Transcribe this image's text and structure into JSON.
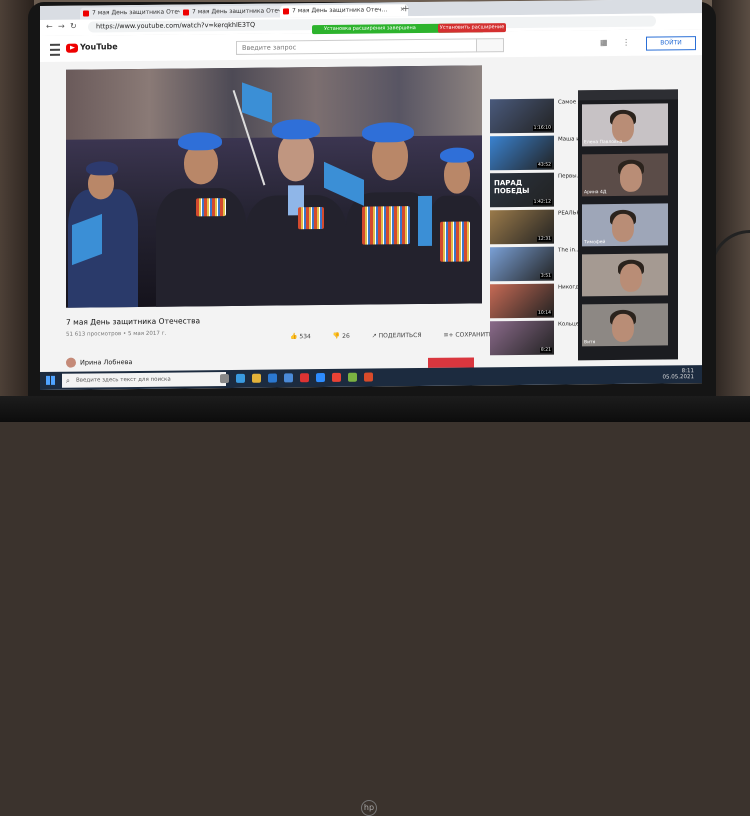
{
  "browser": {
    "tabs": [
      {
        "label": "7 мая День защитника Отеч…",
        "active": false
      },
      {
        "label": "7 мая День защитника Отеч…",
        "active": false
      },
      {
        "label": "7 мая День защитника Отеч…",
        "active": true
      }
    ],
    "url": "https://www.youtube.com/watch?v=kerqkhlE3TQ"
  },
  "youtube": {
    "logo_text": "YouTube",
    "search_placeholder": "Введите запрос",
    "notice_text": "Установка расширения завершена",
    "notice_button": "Установить расширение",
    "signin_label": "ВОЙТИ"
  },
  "video": {
    "title": "7 мая День защитника Отечества",
    "meta": "51 613 просмотров • 5 мая 2017 г.",
    "likes": "534",
    "dislikes": "26",
    "share_label": "ПОДЕЛИТЬСЯ",
    "save_label": "СОХРАНИТЬ",
    "channel": "Ирина Лобнева"
  },
  "suggestions": [
    {
      "title": "Самое т… истори…",
      "duration": "1:16:10",
      "color": "#4a5a7c"
    },
    {
      "title": "Маша и… Эпизод…",
      "duration": "43:52",
      "color": "#3a82d0"
    },
    {
      "title": "Первы… ПАРАД… 75 ЛЕТ…",
      "duration": "1:42:12",
      "color": "#2b3440",
      "label": "ПАРАД ПОБЕДЫ"
    },
    {
      "title": "РЕАЛЬН… военн…",
      "duration": "12:31",
      "color": "#9a7a4a"
    },
    {
      "title": "The in… gravity w…",
      "duration": "3:51",
      "color": "#7aa0d6"
    },
    {
      "title": "Никогда не… сварочн…",
      "duration": "10:14",
      "color": "#c66a55"
    },
    {
      "title": "Кольцев… Москве и…",
      "duration": "8:21",
      "color": "#8a6a8a"
    }
  ],
  "zoom": {
    "participants": [
      {
        "name": "Елена Павловна",
        "bg": "#c7c2c5"
      },
      {
        "name": "Арина 4Д",
        "bg": "#5b4c48"
      },
      {
        "name": "Тимофей",
        "bg": "#9ea6b8"
      },
      {
        "name": "",
        "bg": "#a59a92"
      },
      {
        "name": "Витя",
        "bg": "#8d8884"
      }
    ]
  },
  "taskbar": {
    "search_placeholder": "Введите здесь текст для поиска",
    "time": "8:11",
    "date": "05.05.2021"
  },
  "device": {
    "brand_logo": "hp"
  }
}
